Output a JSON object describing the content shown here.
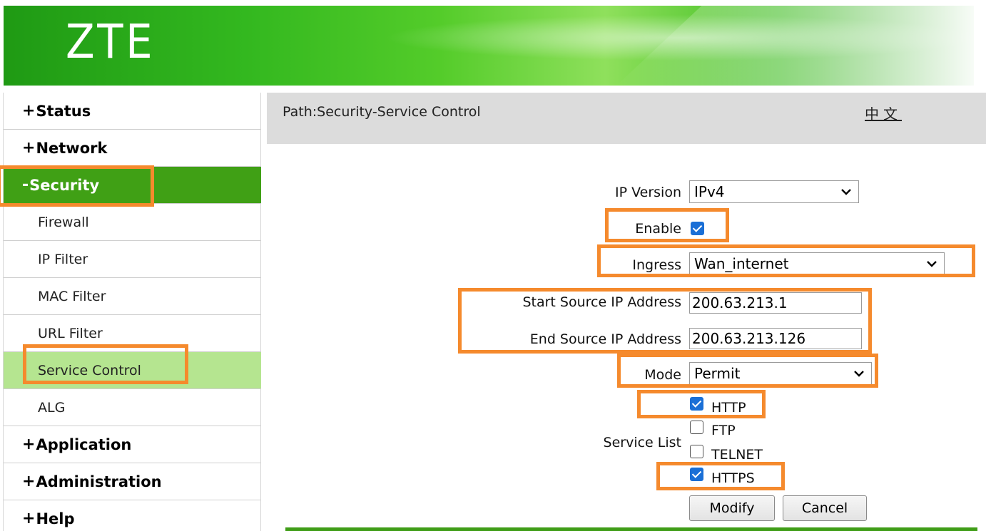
{
  "header": {
    "logo": "ZTE"
  },
  "sidebar": {
    "items": [
      {
        "sign": "+",
        "label": "Status"
      },
      {
        "sign": "+",
        "label": "Network"
      },
      {
        "sign": "-",
        "label": "Security"
      },
      {
        "label": "Firewall"
      },
      {
        "label": "IP Filter"
      },
      {
        "label": "MAC Filter"
      },
      {
        "label": "URL Filter"
      },
      {
        "label": "Service Control"
      },
      {
        "label": "ALG"
      },
      {
        "sign": "+",
        "label": "Application"
      },
      {
        "sign": "+",
        "label": "Administration"
      },
      {
        "sign": "+",
        "label": "Help"
      }
    ]
  },
  "path": {
    "text": "Path:Security-Service Control",
    "lang": "中文"
  },
  "form": {
    "ip_version": {
      "label": "IP Version",
      "value": "IPv4"
    },
    "enable": {
      "label": "Enable",
      "checked": true
    },
    "ingress": {
      "label": "Ingress",
      "value": "Wan_internet"
    },
    "start_ip": {
      "label": "Start Source IP Address",
      "value": "200.63.213.1"
    },
    "end_ip": {
      "label": "End Source IP Address",
      "value": "200.63.213.126"
    },
    "mode": {
      "label": "Mode",
      "value": "Permit"
    },
    "service_list": {
      "label": "Service List",
      "items": [
        {
          "label": "HTTP",
          "checked": true
        },
        {
          "label": "FTP",
          "checked": false
        },
        {
          "label": "TELNET",
          "checked": false
        },
        {
          "label": "HTTPS",
          "checked": true
        }
      ]
    },
    "modify_label": "Modify",
    "cancel_label": "Cancel"
  },
  "colors": {
    "highlight": "#f58a2d",
    "nav_active": "#40a015",
    "nav_selected": "#b5e590",
    "checkbox": "#1a6fd6"
  }
}
